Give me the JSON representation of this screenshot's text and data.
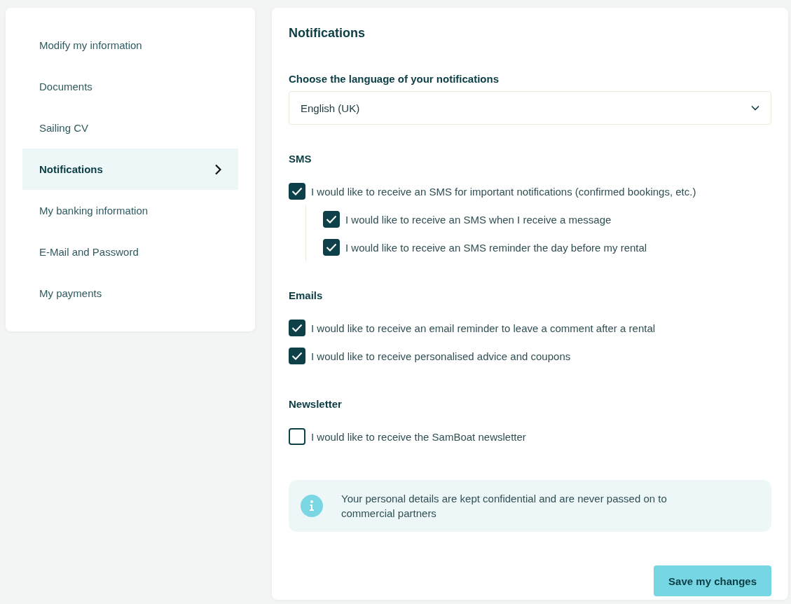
{
  "sidebar": {
    "items": [
      {
        "label": "Modify my information",
        "selected": false
      },
      {
        "label": "Documents",
        "selected": false
      },
      {
        "label": "Sailing CV",
        "selected": false
      },
      {
        "label": "Notifications",
        "selected": true
      },
      {
        "label": "My banking information",
        "selected": false
      },
      {
        "label": "E-Mail and Password",
        "selected": false
      },
      {
        "label": "My payments",
        "selected": false
      }
    ]
  },
  "panel": {
    "title": "Notifications",
    "language": {
      "label": "Choose the language of your notifications",
      "value": "English (UK)"
    },
    "sections": [
      {
        "heading": "SMS",
        "options": [
          {
            "label": "I would like to receive an SMS for important notifications (confirmed bookings, etc.)",
            "checked": true,
            "children": [
              {
                "label": "I would like to receive an SMS when I receive a message",
                "checked": true
              },
              {
                "label": "I would like to receive an SMS reminder the day before my rental",
                "checked": true
              }
            ]
          }
        ]
      },
      {
        "heading": "Emails",
        "options": [
          {
            "label": "I would like to receive an email reminder to leave a comment after a rental",
            "checked": true
          },
          {
            "label": "I would like to receive personalised advice and coupons",
            "checked": true
          }
        ]
      },
      {
        "heading": "Newsletter",
        "options": [
          {
            "label": "I would like to receive the SamBoat newsletter",
            "checked": false
          }
        ]
      }
    ],
    "info": {
      "text": "Your personal details are kept confidential and are never passed on to commercial partners"
    },
    "save_button": {
      "label": "Save my changes"
    }
  }
}
